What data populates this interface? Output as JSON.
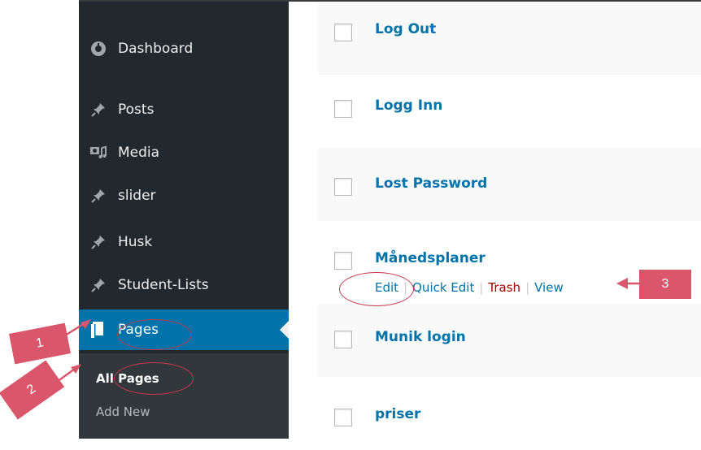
{
  "sidebar": {
    "items": [
      {
        "label": "Dashboard",
        "icon": "dashboard-icon"
      },
      {
        "label": "Posts",
        "icon": "pushpin-icon"
      },
      {
        "label": "Media",
        "icon": "media-icon"
      },
      {
        "label": "slider",
        "icon": "pushpin-icon"
      },
      {
        "label": "Husk",
        "icon": "pushpin-icon"
      },
      {
        "label": "Student-Lists",
        "icon": "pushpin-icon"
      },
      {
        "label": "Pages",
        "icon": "pages-icon"
      }
    ],
    "submenu": {
      "all_pages": "All Pages",
      "add_new": "Add New"
    }
  },
  "pages_list": {
    "rows": [
      {
        "title": "Log Out"
      },
      {
        "title": "Logg Inn"
      },
      {
        "title": "Lost Password"
      },
      {
        "title": "Månedsplaner"
      },
      {
        "title": "Munik login"
      },
      {
        "title": "priser"
      }
    ],
    "row_actions": {
      "edit": "Edit",
      "quick_edit": "Quick Edit",
      "trash": "Trash",
      "view": "View"
    }
  },
  "annotations": {
    "one": "1",
    "two": "2",
    "three": "3"
  },
  "colors": {
    "sidebar_bg": "#23282d",
    "active_bg": "#0073aa",
    "link": "#0073aa",
    "trash": "#a00000",
    "annotation": "#d9566b"
  }
}
